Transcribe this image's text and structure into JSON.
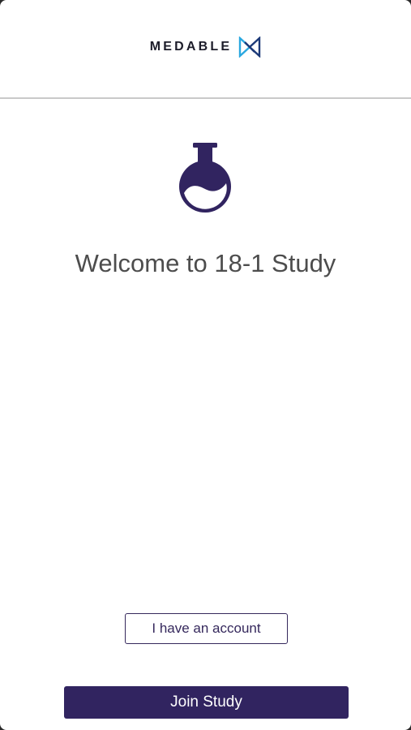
{
  "header": {
    "brand_name": "MEDABLE",
    "logo_icon": "medable-logo-icon"
  },
  "main": {
    "hero_icon": "flask-icon",
    "welcome_text": "Welcome to 18-1 Study"
  },
  "actions": {
    "have_account_label": "I have an account",
    "join_label": "Join Study"
  },
  "colors": {
    "primary": "#312460",
    "logo_accent": "#2aa8e0",
    "text": "#4d4d4d"
  }
}
